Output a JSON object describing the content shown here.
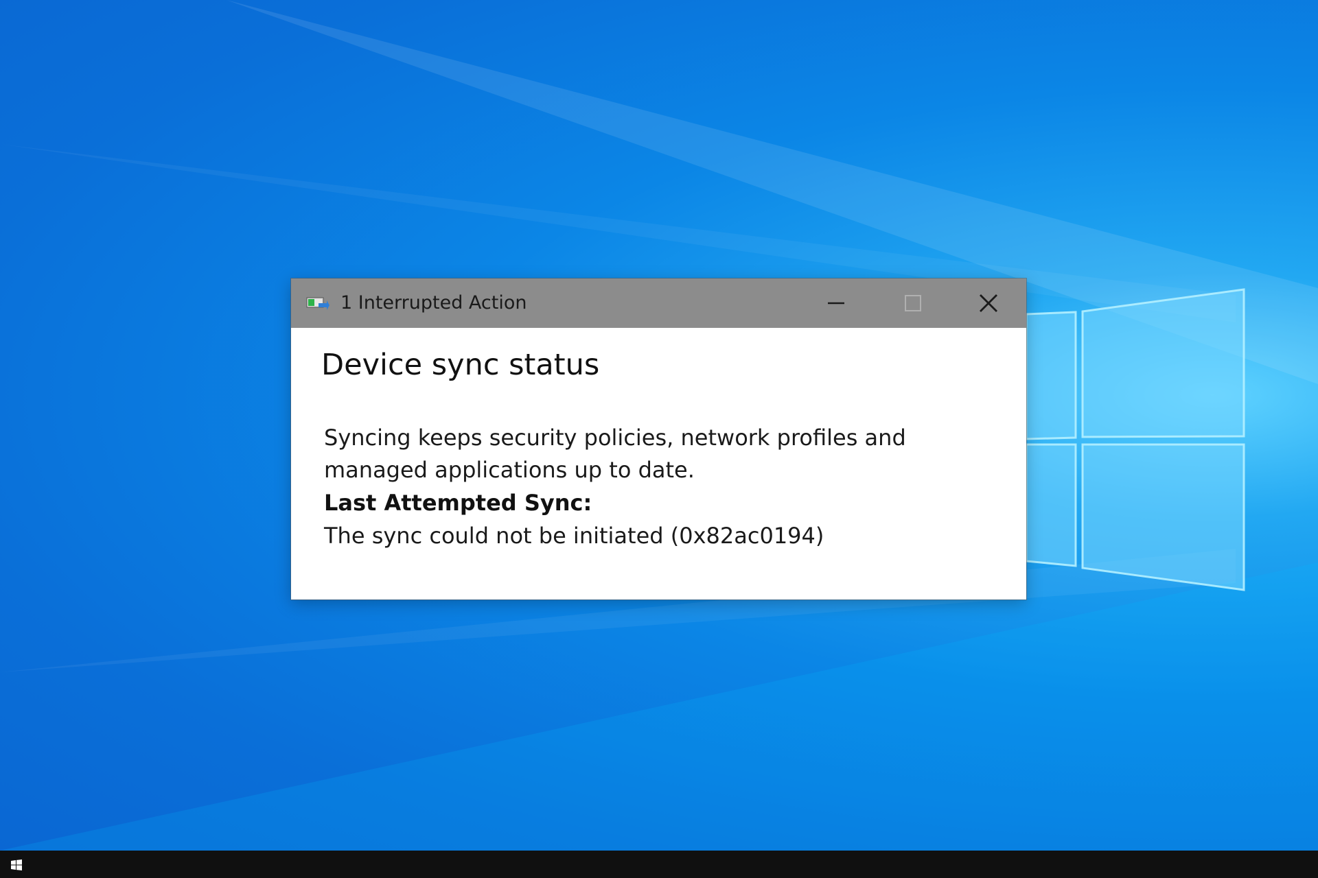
{
  "window": {
    "title": "1 Interrupted Action",
    "app_icon": "sync-app-icon",
    "controls": {
      "minimize_icon": "minimize-icon",
      "maximize_icon": "maximize-icon",
      "close_icon": "close-icon"
    }
  },
  "content": {
    "heading": "Device sync status",
    "description": "Syncing keeps security policies, network profiles and managed applications up to date.",
    "last_sync_label": "Last Attempted Sync:",
    "last_sync_status": "The sync could not be initiated (0x82ac0194)"
  },
  "taskbar": {
    "start_icon": "windows-start-icon"
  },
  "colors": {
    "titlebar": "#8c8c8c",
    "desktop": "#0b86e6",
    "taskbar": "#101010"
  }
}
